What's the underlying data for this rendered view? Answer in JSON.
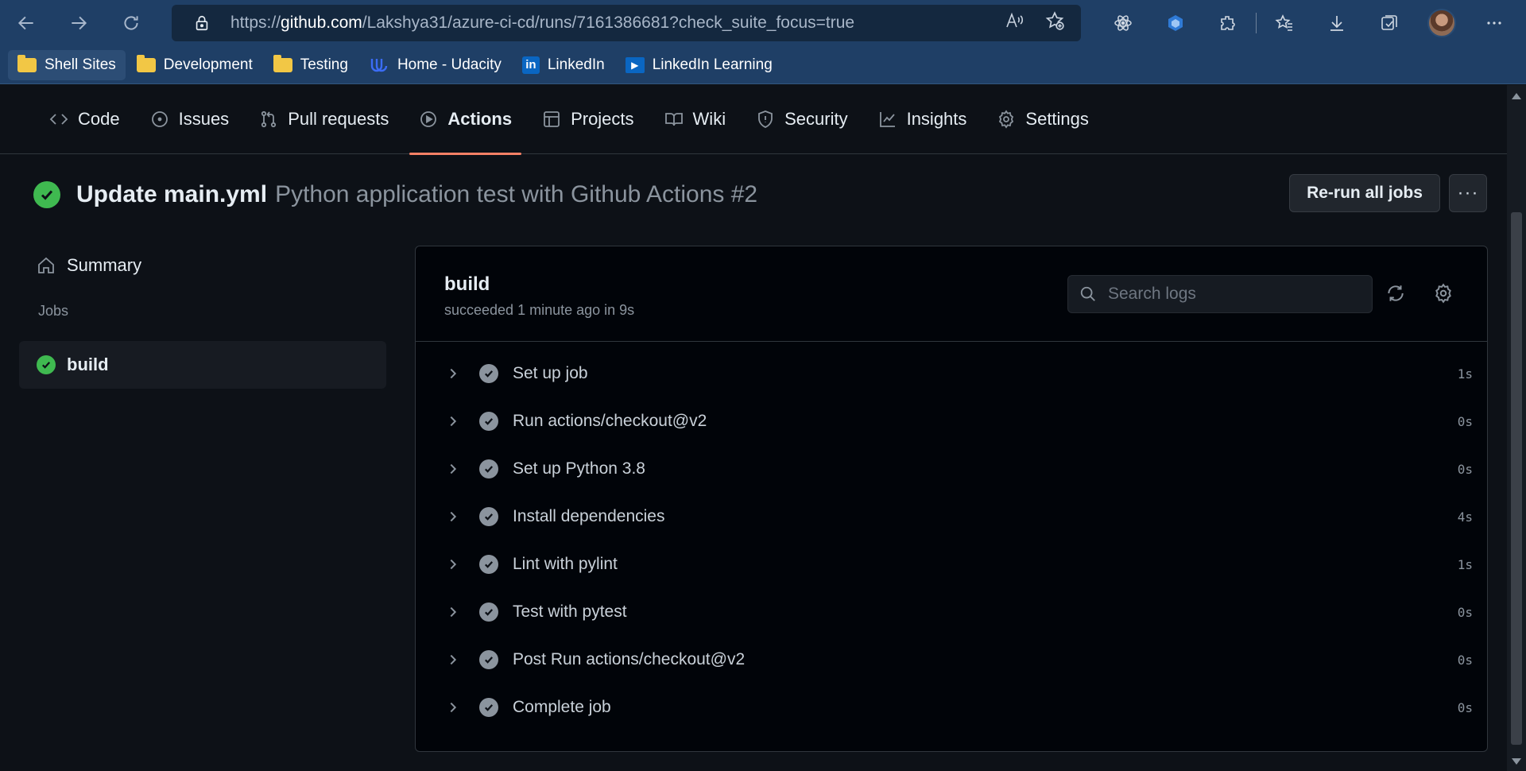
{
  "browser": {
    "url_prefix": "https://",
    "url_host": "github.com",
    "url_path": "/Lakshya31/azure-ci-cd/runs/7161386681?check_suite_focus=true",
    "bookmarks": [
      {
        "label": "Shell Sites",
        "icon": "folder-icon"
      },
      {
        "label": "Development",
        "icon": "folder-icon"
      },
      {
        "label": "Testing",
        "icon": "folder-icon"
      },
      {
        "label": "Home - Udacity",
        "icon": "udacity-icon"
      },
      {
        "label": "LinkedIn",
        "icon": "linkedin-icon"
      },
      {
        "label": "LinkedIn Learning",
        "icon": "linkedin-learning-icon"
      }
    ]
  },
  "repo_nav": {
    "tabs": [
      {
        "label": "Code",
        "icon": "code-icon"
      },
      {
        "label": "Issues",
        "icon": "issue-icon"
      },
      {
        "label": "Pull requests",
        "icon": "pull-request-icon"
      },
      {
        "label": "Actions",
        "icon": "play-icon"
      },
      {
        "label": "Projects",
        "icon": "table-icon"
      },
      {
        "label": "Wiki",
        "icon": "book-icon"
      },
      {
        "label": "Security",
        "icon": "shield-icon"
      },
      {
        "label": "Insights",
        "icon": "graph-icon"
      },
      {
        "label": "Settings",
        "icon": "gear-icon"
      }
    ],
    "selected": "Actions"
  },
  "run": {
    "title": "Update main.yml",
    "subtitle": "Python application test with Github Actions #2",
    "rerun_label": "Re-run all jobs",
    "more_label": "···"
  },
  "sidebar": {
    "summary_label": "Summary",
    "jobs_heading": "Jobs",
    "job_label": "build"
  },
  "job": {
    "name": "build",
    "status": "succeeded 1 minute ago in 9s",
    "search_placeholder": "Search logs",
    "steps": [
      {
        "name": "Set up job",
        "duration": "1s"
      },
      {
        "name": "Run actions/checkout@v2",
        "duration": "0s"
      },
      {
        "name": "Set up Python 3.8",
        "duration": "0s"
      },
      {
        "name": "Install dependencies",
        "duration": "4s"
      },
      {
        "name": "Lint with pylint",
        "duration": "1s"
      },
      {
        "name": "Test with pytest",
        "duration": "0s"
      },
      {
        "name": "Post Run actions/checkout@v2",
        "duration": "0s"
      },
      {
        "name": "Complete job",
        "duration": "0s"
      }
    ]
  },
  "colors": {
    "success": "#3fb950",
    "selected_tab_underline": "#f78166",
    "browser_frame": "#1f3f66"
  }
}
